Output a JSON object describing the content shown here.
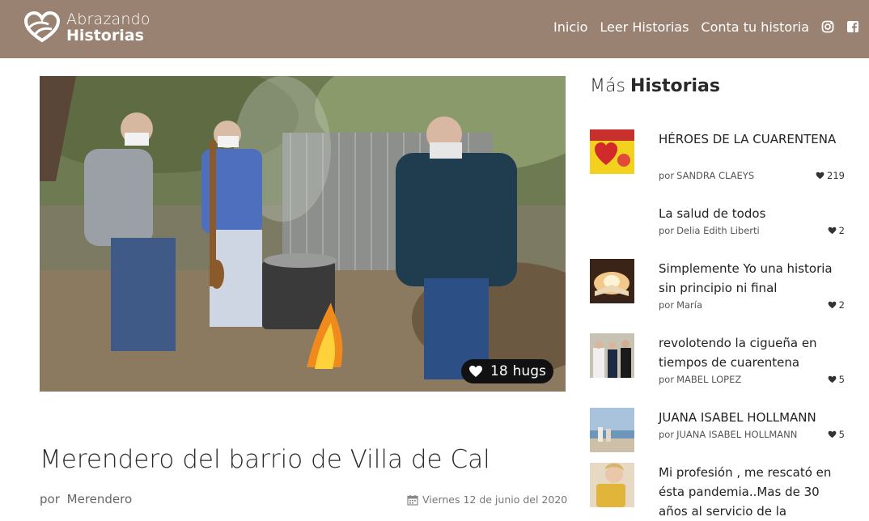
{
  "brand": {
    "line1": "Abrazando",
    "line2": "Historias"
  },
  "nav": {
    "links": [
      "Inicio",
      "Leer Historias",
      "Conta tu historia"
    ],
    "icons": [
      "instagram-icon",
      "facebook-icon"
    ]
  },
  "story": {
    "hugs_count": "18",
    "hugs_word": "hugs",
    "title": "Merendero del barrio de Villa de Cal",
    "by": "por",
    "author": "Merendero",
    "date": "Viernes 12 de junio del 2020"
  },
  "sidebar": {
    "title_pre": "Más",
    "title_strong": "Historias",
    "by": "por",
    "items": [
      {
        "title": "HÉROES DE LA CUARENTENA",
        "author": "SANDRA CLAEYS",
        "likes": "219"
      },
      {
        "title": "La salud de todos",
        "author": "Delia Edith Liberti",
        "likes": "2"
      },
      {
        "title": "Simplemente Yo una historia sin principio ni final",
        "author": "María",
        "likes": "2"
      },
      {
        "title": "revolotendo la cigueña en tiempos de cuarentena",
        "author": "MABEL LOPEZ",
        "likes": "5"
      },
      {
        "title": "JUANA ISABEL HOLLMANN",
        "author": "JUANA ISABEL HOLLMANN",
        "likes": "5"
      },
      {
        "title": "Mi profesión , me rescató en ésta pandemia..Mas de 30 años al servicio de la",
        "author": "",
        "likes": ""
      }
    ]
  },
  "colors": {
    "header": "#9a8273",
    "badge": "#111111"
  }
}
